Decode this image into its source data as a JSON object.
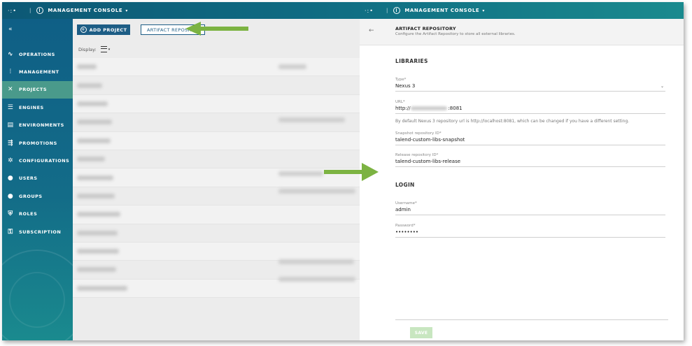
{
  "topbar": {
    "left_title": "MANAGEMENT CONSOLE",
    "right_title": "MANAGEMENT CONSOLE",
    "caret": "▾",
    "logo": "·:•",
    "separator": "|"
  },
  "sidebar": {
    "collapse_icon": "«",
    "items": [
      {
        "label": "OPERATIONS",
        "icon": "pulse-icon",
        "glyph": "∿",
        "active": false
      },
      {
        "label": "MANAGEMENT",
        "icon": "sliders-icon",
        "glyph": "⫶",
        "active": false
      },
      {
        "label": "PROJECTS",
        "icon": "tools-icon",
        "glyph": "✕",
        "active": true
      },
      {
        "label": "ENGINES",
        "icon": "server-icon",
        "glyph": "☰",
        "active": false
      },
      {
        "label": "ENVIRONMENTS",
        "icon": "document-icon",
        "glyph": "▤",
        "active": false
      },
      {
        "label": "PROMOTIONS",
        "icon": "promotion-icon",
        "glyph": "⇶",
        "active": false
      },
      {
        "label": "CONFIGURATIONS",
        "icon": "gear-icon",
        "glyph": "✲",
        "active": false
      },
      {
        "label": "USERS",
        "icon": "user-icon",
        "glyph": "●",
        "active": false
      },
      {
        "label": "GROUPS",
        "icon": "group-icon",
        "glyph": "●",
        "active": false
      },
      {
        "label": "ROLES",
        "icon": "shield-icon",
        "glyph": "⛨",
        "active": false
      },
      {
        "label": "SUBSCRIPTION",
        "icon": "key-icon",
        "glyph": "⚿",
        "active": false
      }
    ]
  },
  "content": {
    "add_project": "ADD PROJECT",
    "artifact_repository": "ARTIFACT REPOSITORY",
    "display_label": "Display:"
  },
  "panel": {
    "back_icon": "←",
    "title": "ARTIFACT REPOSITORY",
    "subtitle": "Configure the Artifact Repository to store all external libraries.",
    "libraries_section": "LIBRARIES",
    "type_label": "Type*",
    "type_value": "Nexus 3",
    "url_label": "URL*",
    "url_prefix": "http://",
    "url_suffix": ":8081",
    "url_hint": "By default Nexus 3 repository url is http://localhost:8081, which can be changed if you have a different setting.",
    "snapshot_label": "Snapshot repository ID*",
    "snapshot_value": "talend-custom-libs-snapshot",
    "release_label": "Release repository ID*",
    "release_value": "talend-custom-libs-release",
    "login_section": "LOGIN",
    "username_label": "Username*",
    "username_value": "admin",
    "password_label": "Password*",
    "password_value": "••••••••",
    "save_label": "SAVE"
  },
  "colors": {
    "arrow": "#7cb342",
    "sidebar_active": "#4a9a8b",
    "primary": "#1d5d85"
  }
}
